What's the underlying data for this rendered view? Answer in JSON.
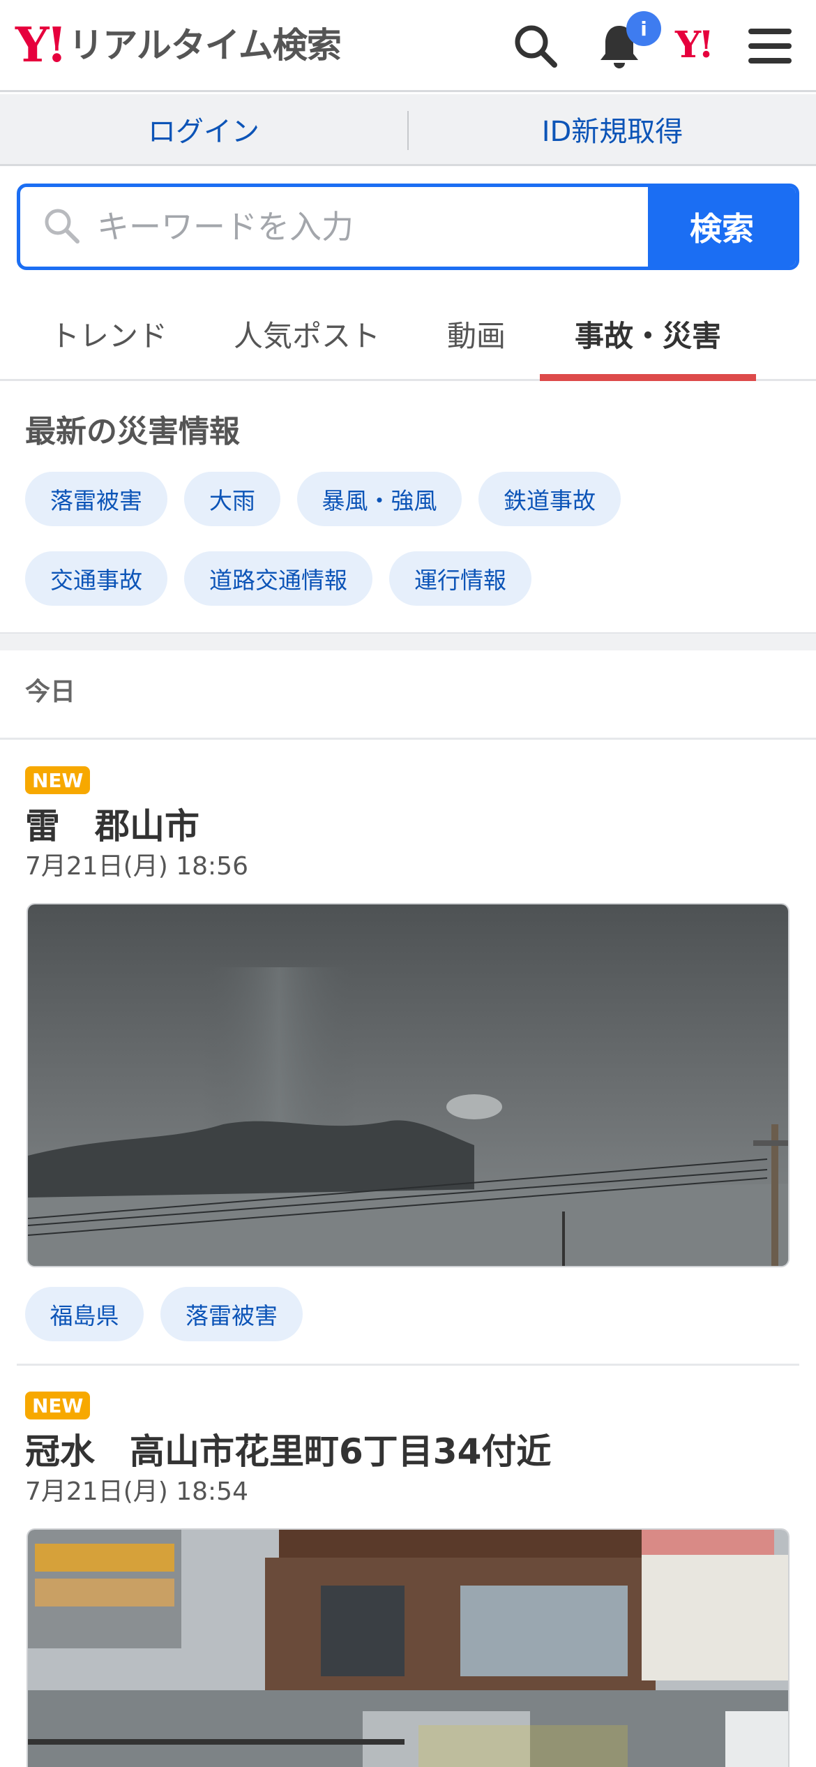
{
  "header": {
    "logo_mark": "Y!",
    "logo_text": "リアルタイム検索",
    "notification_badge": "i",
    "yahoo_mark": "Y!"
  },
  "account": {
    "login_label": "ログイン",
    "signup_label": "ID新規取得"
  },
  "search": {
    "placeholder": "キーワードを入力",
    "button_label": "検索"
  },
  "tabs": [
    {
      "label": "トレンド"
    },
    {
      "label": "人気ポスト"
    },
    {
      "label": "動画"
    },
    {
      "label": "事故・災害"
    }
  ],
  "active_tab": "事故・災害",
  "disaster_section": {
    "title": "最新の災害情報",
    "chips": [
      {
        "label": "落雷被害"
      },
      {
        "label": "大雨"
      },
      {
        "label": "暴風・強風"
      },
      {
        "label": "鉄道事故"
      },
      {
        "label": "交通事故"
      },
      {
        "label": "道路交通情報"
      },
      {
        "label": "運行情報"
      }
    ]
  },
  "feed": {
    "date_header": "今日",
    "posts": [
      {
        "badge": "NEW",
        "title": "雷　郡山市",
        "time": "7月21日(月) 18:56",
        "tags": [
          {
            "label": "福島県"
          },
          {
            "label": "落雷被害"
          }
        ]
      },
      {
        "badge": "NEW",
        "title": "冠水　高山市花里町6丁目34付近",
        "time": "7月21日(月) 18:54"
      }
    ]
  },
  "colors": {
    "brand_red": "#e6003d",
    "link_blue": "#0c54b7",
    "search_blue": "#1b6ef3",
    "tab_underline": "#dd4a4a",
    "new_badge": "#f7a800"
  }
}
